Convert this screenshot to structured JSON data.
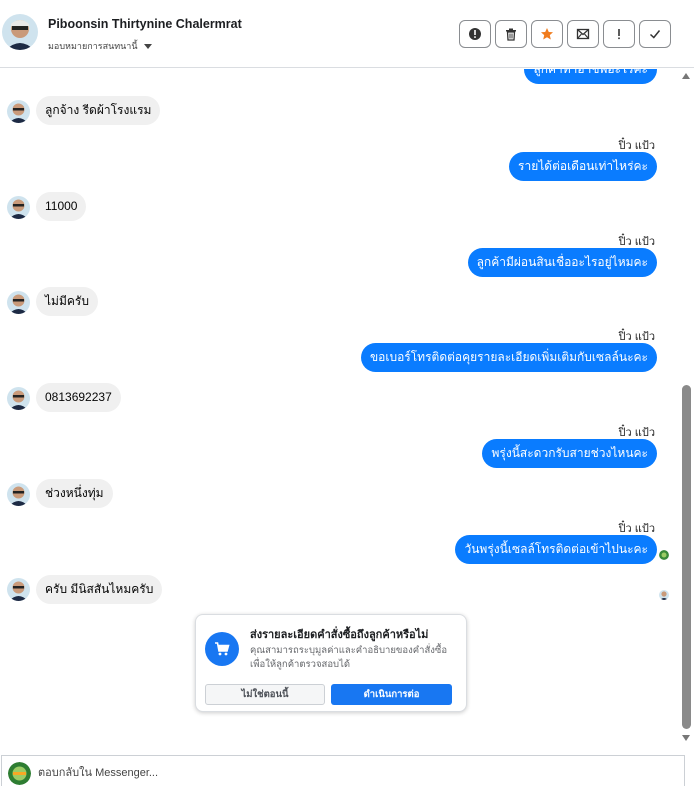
{
  "header": {
    "name": "Piboonsin Thirtynine Chalermrat",
    "assign_label": "มอบหมายการสนทนานี้",
    "actions": [
      {
        "icon": "alert-circle-icon"
      },
      {
        "icon": "trash-icon"
      },
      {
        "icon": "star-icon"
      },
      {
        "icon": "mark-unread-icon"
      },
      {
        "icon": "exclamation-icon"
      },
      {
        "icon": "checkmark-icon"
      }
    ]
  },
  "conversation": {
    "cut_top_message": "ลูกค้าทำอาชีพอะไรคะ",
    "messages": [
      {
        "direction": "in",
        "text": "ลูกจ้าง รีดผ้าโรงแรม"
      },
      {
        "direction": "out",
        "sender": "ปิ๋ว แป้ว",
        "text": "รายได้ต่อเดือนเท่าไหร่คะ"
      },
      {
        "direction": "in",
        "text": "11000"
      },
      {
        "direction": "out",
        "sender": "ปิ๋ว แป้ว",
        "text": "ลูกค้ามีผ่อนสินเชื่ออะไรอยู่ไหมคะ"
      },
      {
        "direction": "in",
        "text": "ไม่มีครับ"
      },
      {
        "direction": "out",
        "sender": "ปิ๋ว แป้ว",
        "text": "ขอเบอร์โทรติดต่อคุยรายละเอียดเพิ่มเติมกับเซลล์นะคะ"
      },
      {
        "direction": "in",
        "text": "0813692237"
      },
      {
        "direction": "out",
        "sender": "ปิ๋ว แป้ว",
        "text": "พรุ่งนี้สะดวกรับสายช่วงไหนคะ"
      },
      {
        "direction": "in",
        "text": "ช่วงหนึ่งทุ่ม"
      },
      {
        "direction": "out",
        "sender": "ปิ๋ว แป้ว",
        "text": "วันพรุ่งนี้เซลล์โทรติดต่อเข้าไปนะคะ"
      },
      {
        "direction": "in",
        "text": "ครับ มีนิสสันไหมครับ"
      }
    ]
  },
  "prompt_card": {
    "title": "ส่งรายละเอียดคำสั่งซื้อถึงลูกค้าหรือไม่",
    "description": "คุณสามารถระบุมูลค่าและคำอธิบายของคำสั่งซื้อเพื่อให้ลูกค้าตรวจสอบได้",
    "decline_label": "ไม่ใช่ตอนนี้",
    "confirm_label": "ดำเนินการต่อ"
  },
  "reply": {
    "placeholder": "ตอบกลับใน Messenger..."
  },
  "colors": {
    "outgoing_bubble": "#0a7cff",
    "incoming_bubble": "#f0f0f0",
    "primary_button": "#1877f2",
    "star": "#f07c1e"
  }
}
